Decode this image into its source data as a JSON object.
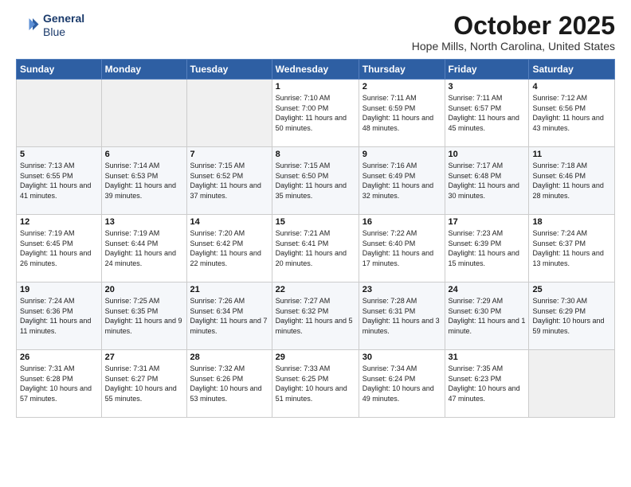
{
  "logo": {
    "line1": "General",
    "line2": "Blue"
  },
  "title": "October 2025",
  "subtitle": "Hope Mills, North Carolina, United States",
  "weekdays": [
    "Sunday",
    "Monday",
    "Tuesday",
    "Wednesday",
    "Thursday",
    "Friday",
    "Saturday"
  ],
  "weeks": [
    [
      {
        "day": "",
        "info": ""
      },
      {
        "day": "",
        "info": ""
      },
      {
        "day": "",
        "info": ""
      },
      {
        "day": "1",
        "info": "Sunrise: 7:10 AM\nSunset: 7:00 PM\nDaylight: 11 hours and 50 minutes."
      },
      {
        "day": "2",
        "info": "Sunrise: 7:11 AM\nSunset: 6:59 PM\nDaylight: 11 hours and 48 minutes."
      },
      {
        "day": "3",
        "info": "Sunrise: 7:11 AM\nSunset: 6:57 PM\nDaylight: 11 hours and 45 minutes."
      },
      {
        "day": "4",
        "info": "Sunrise: 7:12 AM\nSunset: 6:56 PM\nDaylight: 11 hours and 43 minutes."
      }
    ],
    [
      {
        "day": "5",
        "info": "Sunrise: 7:13 AM\nSunset: 6:55 PM\nDaylight: 11 hours and 41 minutes."
      },
      {
        "day": "6",
        "info": "Sunrise: 7:14 AM\nSunset: 6:53 PM\nDaylight: 11 hours and 39 minutes."
      },
      {
        "day": "7",
        "info": "Sunrise: 7:15 AM\nSunset: 6:52 PM\nDaylight: 11 hours and 37 minutes."
      },
      {
        "day": "8",
        "info": "Sunrise: 7:15 AM\nSunset: 6:50 PM\nDaylight: 11 hours and 35 minutes."
      },
      {
        "day": "9",
        "info": "Sunrise: 7:16 AM\nSunset: 6:49 PM\nDaylight: 11 hours and 32 minutes."
      },
      {
        "day": "10",
        "info": "Sunrise: 7:17 AM\nSunset: 6:48 PM\nDaylight: 11 hours and 30 minutes."
      },
      {
        "day": "11",
        "info": "Sunrise: 7:18 AM\nSunset: 6:46 PM\nDaylight: 11 hours and 28 minutes."
      }
    ],
    [
      {
        "day": "12",
        "info": "Sunrise: 7:19 AM\nSunset: 6:45 PM\nDaylight: 11 hours and 26 minutes."
      },
      {
        "day": "13",
        "info": "Sunrise: 7:19 AM\nSunset: 6:44 PM\nDaylight: 11 hours and 24 minutes."
      },
      {
        "day": "14",
        "info": "Sunrise: 7:20 AM\nSunset: 6:42 PM\nDaylight: 11 hours and 22 minutes."
      },
      {
        "day": "15",
        "info": "Sunrise: 7:21 AM\nSunset: 6:41 PM\nDaylight: 11 hours and 20 minutes."
      },
      {
        "day": "16",
        "info": "Sunrise: 7:22 AM\nSunset: 6:40 PM\nDaylight: 11 hours and 17 minutes."
      },
      {
        "day": "17",
        "info": "Sunrise: 7:23 AM\nSunset: 6:39 PM\nDaylight: 11 hours and 15 minutes."
      },
      {
        "day": "18",
        "info": "Sunrise: 7:24 AM\nSunset: 6:37 PM\nDaylight: 11 hours and 13 minutes."
      }
    ],
    [
      {
        "day": "19",
        "info": "Sunrise: 7:24 AM\nSunset: 6:36 PM\nDaylight: 11 hours and 11 minutes."
      },
      {
        "day": "20",
        "info": "Sunrise: 7:25 AM\nSunset: 6:35 PM\nDaylight: 11 hours and 9 minutes."
      },
      {
        "day": "21",
        "info": "Sunrise: 7:26 AM\nSunset: 6:34 PM\nDaylight: 11 hours and 7 minutes."
      },
      {
        "day": "22",
        "info": "Sunrise: 7:27 AM\nSunset: 6:32 PM\nDaylight: 11 hours and 5 minutes."
      },
      {
        "day": "23",
        "info": "Sunrise: 7:28 AM\nSunset: 6:31 PM\nDaylight: 11 hours and 3 minutes."
      },
      {
        "day": "24",
        "info": "Sunrise: 7:29 AM\nSunset: 6:30 PM\nDaylight: 11 hours and 1 minute."
      },
      {
        "day": "25",
        "info": "Sunrise: 7:30 AM\nSunset: 6:29 PM\nDaylight: 10 hours and 59 minutes."
      }
    ],
    [
      {
        "day": "26",
        "info": "Sunrise: 7:31 AM\nSunset: 6:28 PM\nDaylight: 10 hours and 57 minutes."
      },
      {
        "day": "27",
        "info": "Sunrise: 7:31 AM\nSunset: 6:27 PM\nDaylight: 10 hours and 55 minutes."
      },
      {
        "day": "28",
        "info": "Sunrise: 7:32 AM\nSunset: 6:26 PM\nDaylight: 10 hours and 53 minutes."
      },
      {
        "day": "29",
        "info": "Sunrise: 7:33 AM\nSunset: 6:25 PM\nDaylight: 10 hours and 51 minutes."
      },
      {
        "day": "30",
        "info": "Sunrise: 7:34 AM\nSunset: 6:24 PM\nDaylight: 10 hours and 49 minutes."
      },
      {
        "day": "31",
        "info": "Sunrise: 7:35 AM\nSunset: 6:23 PM\nDaylight: 10 hours and 47 minutes."
      },
      {
        "day": "",
        "info": ""
      }
    ]
  ]
}
